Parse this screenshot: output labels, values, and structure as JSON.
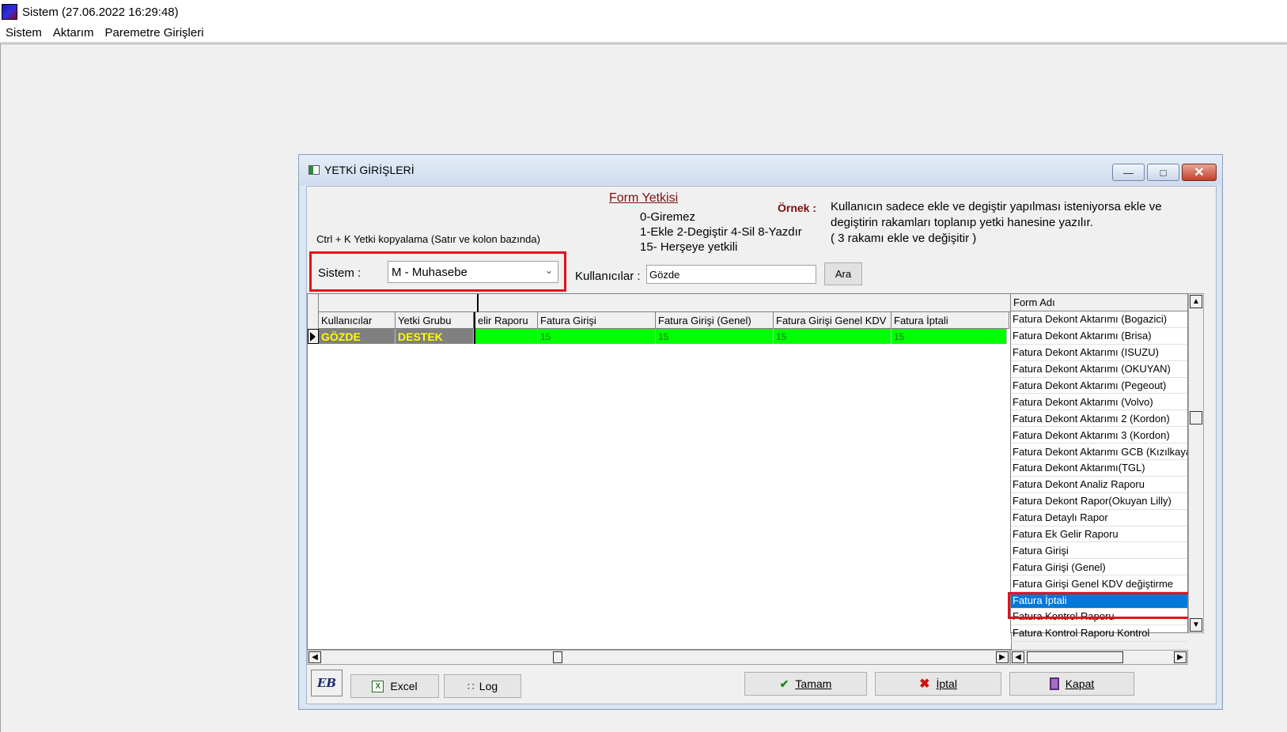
{
  "app": {
    "title": "Sistem (27.06.2022 16:29:48)",
    "menu": [
      "Sistem",
      "Aktarım",
      "Paremetre Girişleri"
    ]
  },
  "dialog": {
    "title": "YETKİ GİRİŞLERİ",
    "window_buttons": {
      "minimize": "—",
      "maximize": "□",
      "close": "✕"
    }
  },
  "header": {
    "form_yetkisi": "Form Yetkisi",
    "ornek_label": "Örnek :",
    "ornek_text": "Kullanıcın sadece ekle ve degiştir yapılması isteniyorsa  ekle ve degiştirin rakamları toplanıp yetki hanesine yazılır.\n ( 3 rakamı ekle ve değişitir )",
    "legend": [
      "0-Giremez",
      "1-Ekle  2-Degiştir  4-Sil  8-Yazdır",
      "15- Herşeye yetkili"
    ],
    "ctrl_hint": "Ctrl + K Yetki kopyalama (Satır ve kolon bazında)"
  },
  "filters": {
    "sistem_label": "Sistem :",
    "sistem_value": "M - Muhasebe",
    "kullanicilar_label": "Kullanıcılar :",
    "kullanicilar_value": "Gözde",
    "ara_label": "Ara"
  },
  "grid": {
    "fixed_columns": [
      "Kullanıcılar",
      "Yetki Grubu"
    ],
    "columns": [
      "elir Raporu",
      "Fatura Girişi",
      "Fatura Girişi (Genel)",
      "Fatura Girişi Genel KDV",
      "Fatura İptali"
    ],
    "rows": [
      {
        "user": "GÖZDE",
        "group": "DESTEK",
        "values": [
          "",
          "15",
          "15",
          "15",
          "15"
        ]
      }
    ]
  },
  "formlist": {
    "header": "Form Adı",
    "items": [
      "Fatura Dekont Aktarımı (Bogazici)",
      "Fatura Dekont Aktarımı (Brisa)",
      "Fatura Dekont Aktarımı (ISUZU)",
      "Fatura Dekont Aktarımı (OKUYAN)",
      "Fatura Dekont Aktarımı (Pegeout)",
      "Fatura Dekont Aktarımı (Volvo)",
      "Fatura Dekont Aktarımı 2 (Kordon)",
      "Fatura Dekont Aktarımı 3 (Kordon)",
      "Fatura Dekont Aktarımı GCB (Kızılkaya)",
      "Fatura Dekont Aktarımı(TGL)",
      "Fatura Dekont Analiz Raporu",
      "Fatura Dekont Rapor(Okuyan Lilly)",
      "Fatura Detaylı Rapor",
      "Fatura Ek Gelir Raporu",
      "Fatura Girişi",
      "Fatura Girişi (Genel)",
      "Fatura Girişi Genel KDV değiştirme",
      "Fatura İptali",
      "Fatura Kontrol Raporu",
      "Fatura Kontrol Raporu Kontrol"
    ],
    "selected": "Fatura İptali"
  },
  "buttons": {
    "logo": "EB",
    "excel": "Excel",
    "log": "Log",
    "tamam": "Tamam",
    "iptal": "İptal",
    "kapat": "Kapat"
  },
  "colors": {
    "highlight": "#e3111c",
    "row_green": "#00ff00",
    "fixed_text": "#ffff00",
    "selection": "#0078d7",
    "accent_red": "#7a0f0f"
  }
}
